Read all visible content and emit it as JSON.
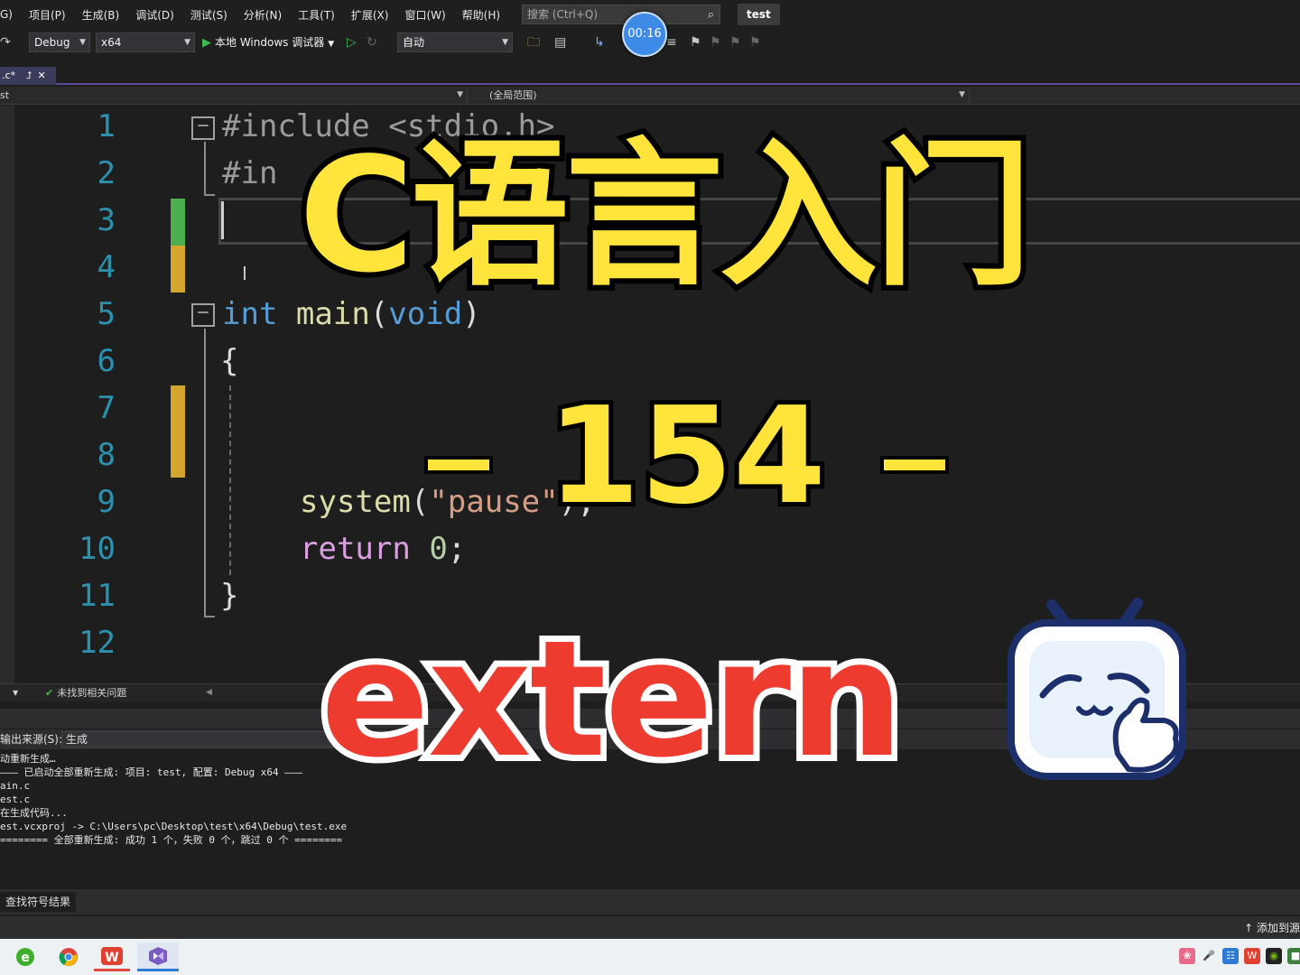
{
  "menubar": {
    "items": [
      "G)",
      "项目(P)",
      "生成(B)",
      "调试(D)",
      "测试(S)",
      "分析(N)",
      "工具(T)",
      "扩展(X)",
      "窗口(W)",
      "帮助(H)"
    ],
    "search_placeholder": "搜索 (Ctrl+Q)",
    "solution_name": "test"
  },
  "toolbar": {
    "configuration": "Debug",
    "platform": "x64",
    "run_label": "本地 Windows 调试器",
    "auto_label": "自动"
  },
  "timer": "00:16",
  "editor_tab": {
    "filename": ".c*"
  },
  "navbar": {
    "project": "st",
    "scope": "(全局范围)"
  },
  "code": {
    "line_numbers": [
      "1",
      "2",
      "3",
      "4",
      "5",
      "6",
      "7",
      "8",
      "9",
      "10",
      "11",
      "12"
    ],
    "line1": "#include <stdio.h>",
    "line2": "#in",
    "line5_kw": "int",
    "line5_fn": "main",
    "line5_open": "(",
    "line5_param": "void",
    "line5_close": ")",
    "line6": "{",
    "line9_fn": "system",
    "line9_open": "(",
    "line9_str": "\"pause\"",
    "line9_end": ");",
    "line10_kw": "return",
    "line10_num": "0",
    "line10_end": ";",
    "line11": "}"
  },
  "error_bar": {
    "status": "未找到相关问题"
  },
  "output": {
    "source_label": "输出来源(S):",
    "source_value": "生成",
    "lines": [
      "动重新生成…",
      "——— 已启动全部重新生成: 项目: test, 配置: Debug x64 ———",
      "ain.c",
      "est.c",
      "在生成代码...",
      "est.vcxproj -> C:\\Users\\pc\\Desktop\\test\\x64\\Debug\\test.exe",
      "======== 全部重新生成: 成功 1 个，失败 0 个，跳过 0 个 ========"
    ]
  },
  "bottom_tab": "查找符号结果",
  "status_right": "添加到源",
  "overlay": {
    "title": "C语言入门",
    "episode": "154",
    "topic": "extern"
  },
  "colors": {
    "title_yellow": "#ffe53b",
    "topic_red": "#ee3b2f",
    "line_number_blue": "#2b91af",
    "keyword_blue": "#569cd6",
    "change_green": "#4caf50",
    "change_yellow": "#d4a72c"
  }
}
